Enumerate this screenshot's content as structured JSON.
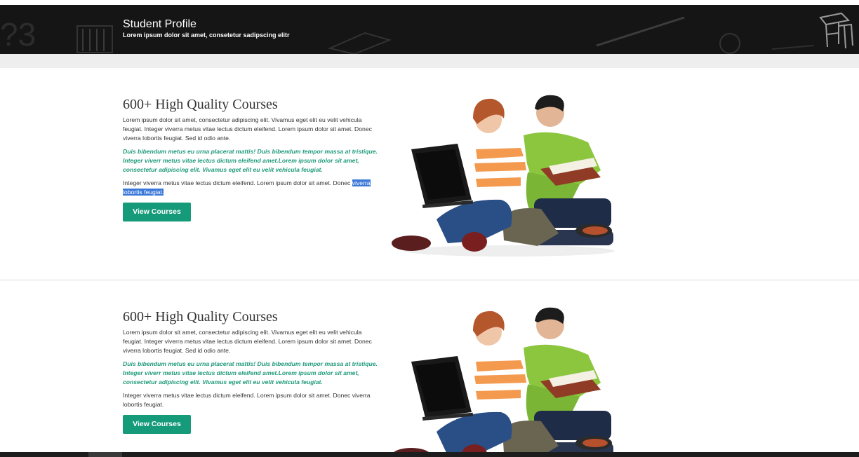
{
  "header": {
    "title": "Student Profile",
    "subtitle": "Lorem ipsum dolor sit amet, consetetur sadipscing elitr"
  },
  "sections": [
    {
      "title": "600+ High Quality Courses",
      "para1": "Lorem ipsum dolor sit amet, consectetur adipiscing elit. Vivamus eget elit eu velit vehicula feugiat. Integer viverra metus vitae lectus dictum eleifend. Lorem ipsum dolor sit amet. Donec viverra lobortis feugiat. Sed id odio ante.",
      "emphasis": "Duis bibendum metus eu urna placerat mattis! Duis bibendum tempor massa at tristique. Integer viverr metus vitae lectus dictum eleifend amet.Lorem ipsum dolor sit amet, consectetur adipiscing elit. Vivamus eget elit eu velit vehicula feugiat.",
      "para2_start": "Integer viverra metus vitae lectus dictum eleifend. Lorem ipsum dolor sit amet. Donec",
      "para2_selected": "viverra lobortis feugiat.",
      "button": "View Courses"
    },
    {
      "title": "600+ High Quality Courses",
      "para1": "Lorem ipsum dolor sit amet, consectetur adipiscing elit. Vivamus eget elit eu velit vehicula feugiat. Integer viverra metus vitae lectus dictum eleifend. Lorem ipsum dolor sit amet. Donec viverra lobortis feugiat. Sed id odio ante.",
      "emphasis": "Duis bibendum metus eu urna placerat mattis! Duis bibendum tempor massa at tristique. Integer viverr metus vitae lectus dictum eleifend amet.Lorem ipsum dolor sit amet, consectetur adipiscing elit. Vivamus eget elit eu velit vehicula feugiat.",
      "para2": "Integer viverra metus vitae lectus dictum eleifend. Lorem ipsum dolor sit amet. Donec viverra lobortis feugiat.",
      "button": "View Courses"
    }
  ],
  "colors": {
    "accent": "#159a7a",
    "header_bg": "#151515",
    "selection": "#3b78d8"
  }
}
